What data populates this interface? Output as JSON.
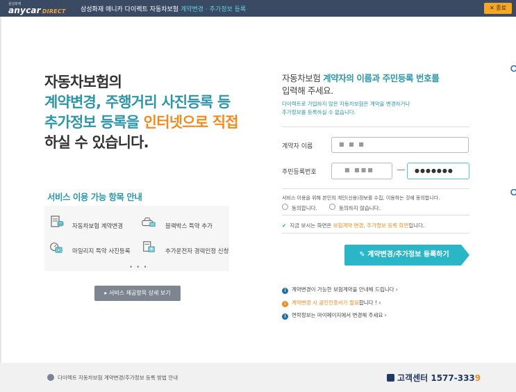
{
  "topbar": {
    "logo_small": "삼성화재",
    "logo_main": "anycar",
    "logo_direct": "DIRECT",
    "title": "삼성화재 애니카 다이렉트 자동차보험",
    "subtitle": "계약변경 · 추가정보 등록",
    "close_label": "✕ 종료"
  },
  "headline": {
    "line1": "자동차보험의",
    "line2": "계약변경, 주행거리 사진등록 등",
    "line3_a": "추가정보 등록을 ",
    "line3_b": "인터넷으로 직접",
    "line4": "하실 수 있습니다."
  },
  "services": {
    "title": "서비스 이용 가능 항목 안내",
    "items": [
      {
        "icon": "document-coins-icon",
        "label": "자동차보험 계약변경"
      },
      {
        "icon": "car-blackbox-icon",
        "label": "블랙박스 특약 추가"
      },
      {
        "icon": "camera-odometer-icon",
        "label": "마일리지 특약 사진등록"
      },
      {
        "icon": "driver-id-icon",
        "label": "추가운전자 경력인정 신청"
      }
    ],
    "more": "• • •",
    "detail_button": "▸ 서비스 제공항목 상세 보기"
  },
  "form": {
    "title_a": "자동차보험 ",
    "title_b": "계약자의 이름과 주민등록 번호를",
    "title_c": "입력해 주세요.",
    "note1": "다이렉트로 가입하지 않은 자동차보험은 계약을 변경하거나",
    "note2": "추가정보를 등록하실 수 없습니다.",
    "name_label": "계약자 이름",
    "name_value": "■ ■ ■",
    "rrn_label": "주민등록번호",
    "rrn_front": "■ ■■■",
    "rrn_back": "●●●●●●●",
    "consent_text": "서비스 이용을 위해 본인의 개인(신용)정보를 수집, 이용하는 것에 동의합니다.",
    "agree_label": "동의합니다.",
    "disagree_label": "동의하지 않습니다.",
    "notice_a": "지금 보시는 화면은 ",
    "notice_b": "보험계약 변경, 추가정보 등록 화면",
    "notice_c": "입니다.",
    "submit_label": "계약변경/추가정보 등록하기"
  },
  "info": [
    {
      "text": "계약변경이 가능한 보험계약을 안내해 드립니다 ›"
    },
    {
      "text_a": "계약변경 시 공인인증서가 필요",
      "text_b": "합니다 ! ›"
    },
    {
      "text": "연락정보는 마이페이지에서 변경해 주세요 ›"
    }
  ],
  "footer": {
    "guide_link": "다이렉트 자동차보험 계약변경/추가정보 등록 방법 안내",
    "cc_label": "고객센터 ",
    "cc_number": "1577-333",
    "cc_last": "9"
  },
  "colors": {
    "teal": "#2e95a8",
    "orange": "#f28b1f",
    "navy": "#3b4a63",
    "button": "#2bb6c8"
  }
}
